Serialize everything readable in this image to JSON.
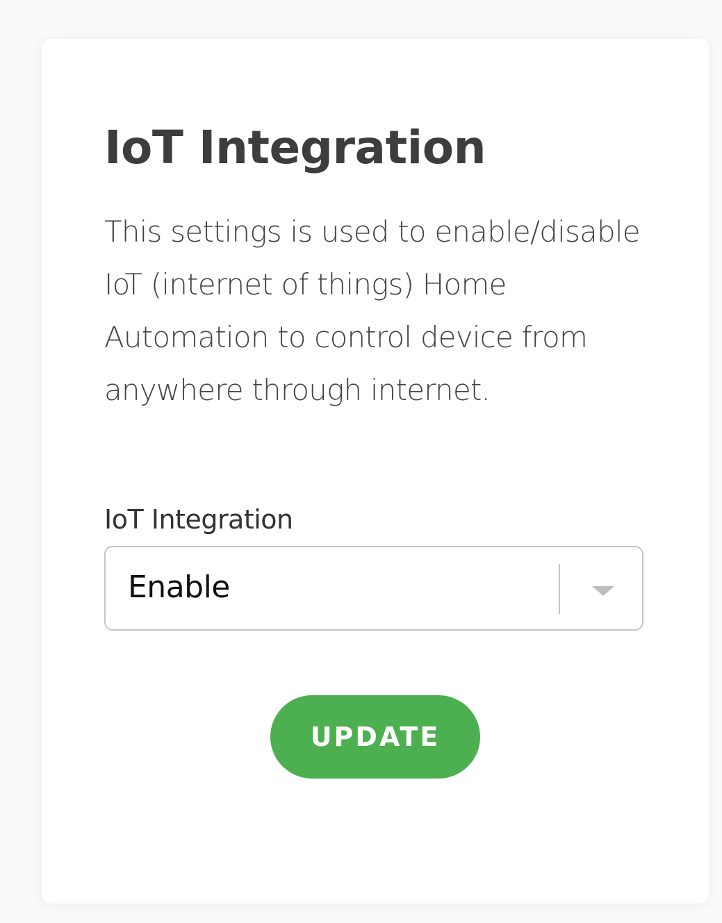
{
  "card": {
    "title": "IoT Integration",
    "description": "This settings is used to enable/disable IoT (internet of things) Home Automation to control device from anywhere through internet.",
    "field": {
      "label": "IoT Integration",
      "selected_value": "Enable",
      "icon": "chevron-down-icon"
    },
    "update_button": "UPDATE",
    "colors": {
      "accent": "#4caf50",
      "title": "#3d3d3d",
      "border": "#c4c4c4"
    }
  }
}
